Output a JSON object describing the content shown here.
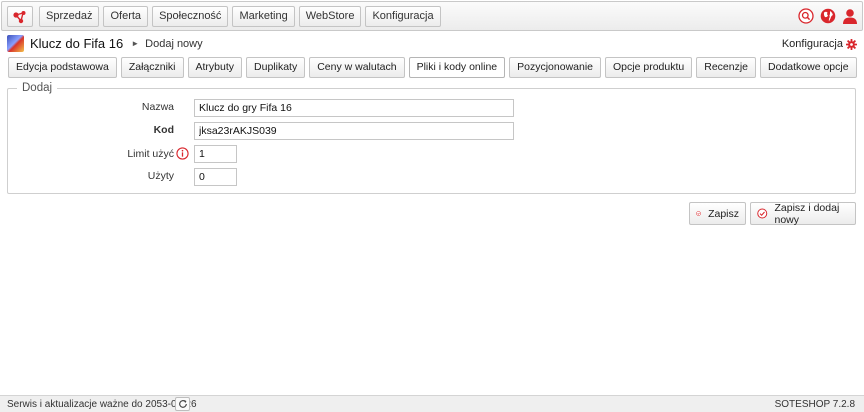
{
  "topbar": {
    "logo_icon": "soteshop-logo-icon",
    "menu": [
      {
        "label": "Sprzedaż"
      },
      {
        "label": "Oferta"
      },
      {
        "label": "Społeczność"
      },
      {
        "label": "Marketing"
      },
      {
        "label": "WebStore"
      },
      {
        "label": "Konfiguracja"
      }
    ],
    "icons": [
      "search-icon",
      "globe-icon",
      "user-icon"
    ]
  },
  "header": {
    "title": "Klucz do Fifa 16",
    "breadcrumb_separator": "►",
    "breadcrumb_current": "Dodaj nowy",
    "config_label": "Konfiguracja"
  },
  "tabs": [
    {
      "label": "Edycja podstawowa",
      "active": false
    },
    {
      "label": "Załączniki",
      "active": false
    },
    {
      "label": "Atrybuty",
      "active": false
    },
    {
      "label": "Duplikaty",
      "active": false
    },
    {
      "label": "Ceny w walutach",
      "active": false
    },
    {
      "label": "Pliki i kody online",
      "active": true
    },
    {
      "label": "Pozycjonowanie",
      "active": false
    },
    {
      "label": "Opcje produktu",
      "active": false
    },
    {
      "label": "Recenzje",
      "active": false
    },
    {
      "label": "Dodatkowe opcje",
      "active": false
    }
  ],
  "form": {
    "legend": "Dodaj",
    "fields": {
      "nazwa": {
        "label": "Nazwa",
        "value": "Klucz do gry Fifa 16"
      },
      "kod": {
        "label": "Kod",
        "value": "jksa23rAKJS039"
      },
      "limit": {
        "label": "Limit użyć",
        "value": "1"
      },
      "uzyty": {
        "label": "Użyty",
        "value": "0"
      }
    }
  },
  "actions": {
    "save_label": "Zapisz",
    "save_new_label": "Zapisz i dodaj nowy"
  },
  "footer": {
    "service_text": "Serwis i aktualizacje ważne do 2053-08-26",
    "version": "SOTESHOP 7.2.8"
  },
  "colors": {
    "accent_red": "#d9262c"
  }
}
